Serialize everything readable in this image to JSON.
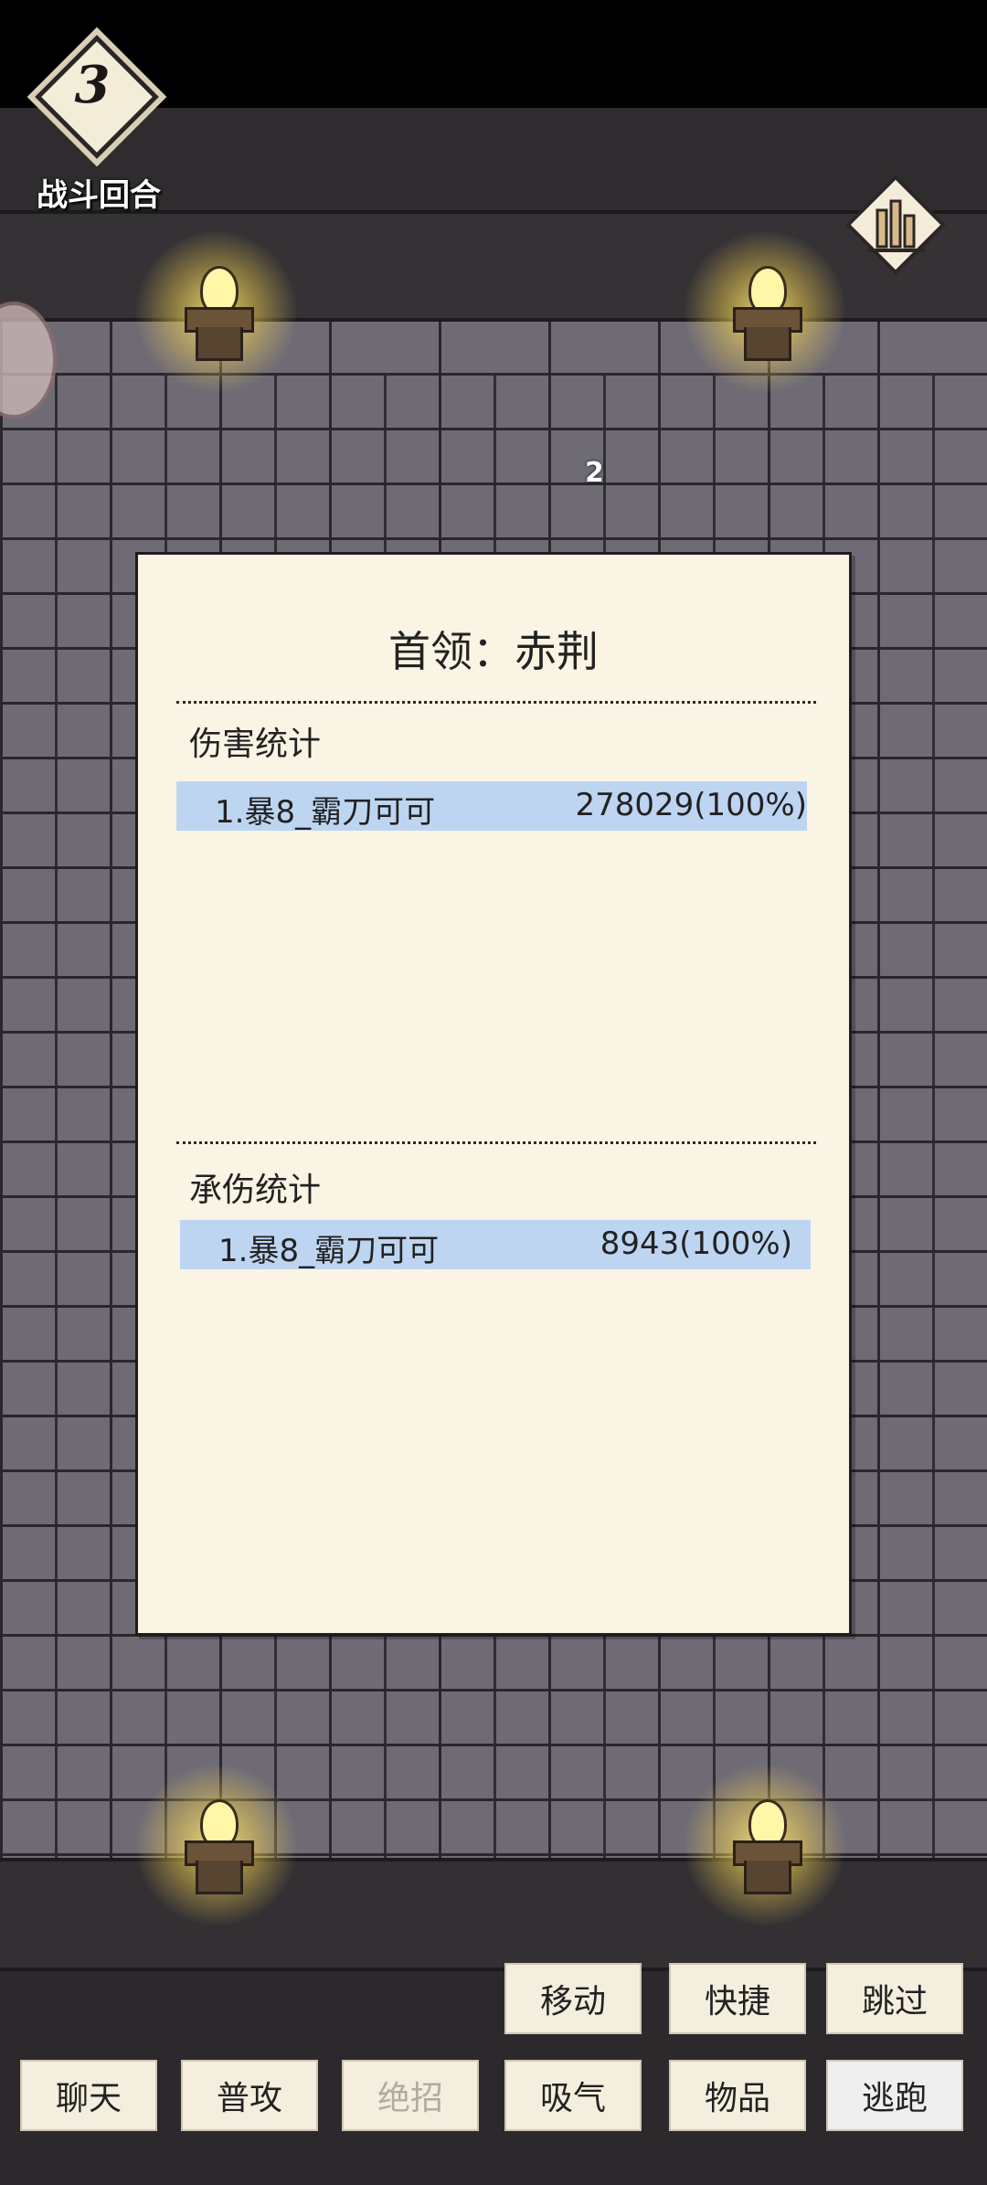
{
  "hud": {
    "round_number": "3",
    "round_label": "战斗回合",
    "floating_number": "2"
  },
  "panel": {
    "title": "首领：赤荆",
    "damage_section": {
      "label": "伤害统计",
      "rows": [
        {
          "name": "1.暴8_霸刀可可",
          "value": "278029(100%)"
        }
      ]
    },
    "taken_section": {
      "label": "承伤统计",
      "rows": [
        {
          "name": "1.暴8_霸刀可可",
          "value": "8943(100%)"
        }
      ]
    }
  },
  "actions": {
    "move": "移动",
    "quick": "快捷",
    "skip": "跳过",
    "chat": "聊天",
    "attack": "普攻",
    "ultimate": "绝招",
    "breathe": "吸气",
    "items": "物品",
    "flee": "逃跑"
  },
  "colors": {
    "panel_bg": "#faf4e4",
    "row_highlight": "#bed5f2",
    "wall": "#6f6b75"
  }
}
